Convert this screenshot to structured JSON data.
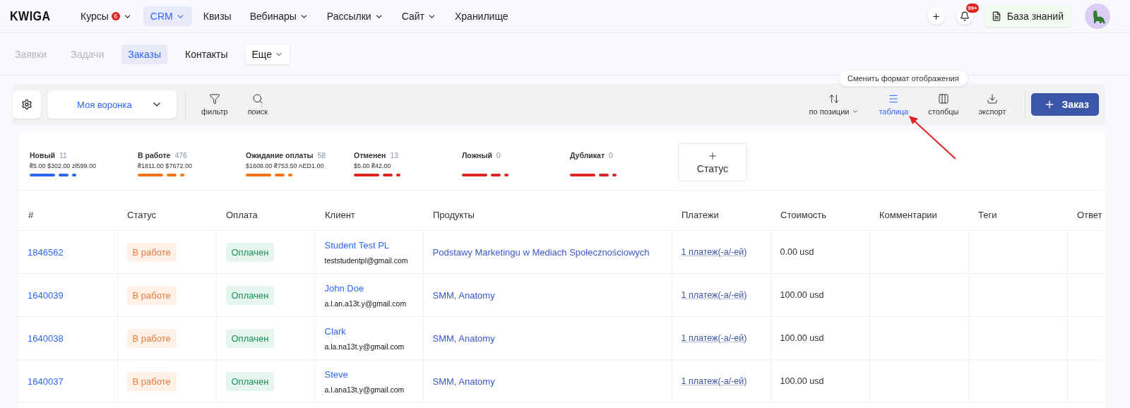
{
  "logo": "KWIGA",
  "nav": [
    {
      "label": "Курсы",
      "selected": false,
      "menu": true,
      "badge": "6"
    },
    {
      "label": "CRM",
      "selected": true,
      "menu": true
    },
    {
      "label": "Квизы",
      "selected": false,
      "menu": false
    },
    {
      "label": "Вебинары",
      "selected": false,
      "menu": true
    },
    {
      "label": "Рассылки",
      "selected": false,
      "menu": true
    },
    {
      "label": "Сайт",
      "selected": false,
      "menu": true
    },
    {
      "label": "Хранилище",
      "selected": false,
      "menu": false
    }
  ],
  "header_actions": {
    "notifications_badge": "99+",
    "knowledge_base": "База знаний"
  },
  "subnav": [
    {
      "label": "Заявки",
      "selected": false,
      "disabled": true
    },
    {
      "label": "Задачи",
      "selected": false,
      "disabled": true
    },
    {
      "label": "Заказы",
      "selected": true,
      "disabled": false
    },
    {
      "label": "Контакты",
      "selected": false,
      "disabled": false
    }
  ],
  "subnav_more": "Еще",
  "toolbar": {
    "funnel": "Моя воронка",
    "left_tools": [
      {
        "kind": "filter",
        "label": "фильтр"
      },
      {
        "kind": "search",
        "label": "поиск"
      }
    ],
    "right_tools": [
      {
        "kind": "sort",
        "label": "по позиции",
        "selected": false,
        "menu": true
      },
      {
        "kind": "table",
        "label": "таблица",
        "selected": true,
        "menu": false
      },
      {
        "kind": "columns",
        "label": "столбцы",
        "selected": false,
        "menu": false
      },
      {
        "kind": "export",
        "label": "экспорт",
        "selected": false,
        "menu": false
      }
    ],
    "tooltip": "Сменить формат отображения",
    "add_button": "Заказ"
  },
  "statuses": [
    {
      "name": "Новый",
      "count": "11",
      "amounts": "₴5.00 $302.00 zł599.00",
      "color": "#2f66f6"
    },
    {
      "name": "В работе",
      "count": "476",
      "amounts": "₴1811.00 $7672.00",
      "color": "#f97316"
    },
    {
      "name": "Ожидание оплаты",
      "count": "58",
      "amounts": "$1608.00 ₴753.50 AED1.00",
      "color": "#f97316"
    },
    {
      "name": "Отменен",
      "count": "13",
      "amounts": "$5.00 ₴42.00",
      "color": "#dc2626"
    },
    {
      "name": "Ложный",
      "count": "0",
      "color": "#dc2626"
    },
    {
      "name": "Дубликат",
      "count": "0",
      "color": "#dc2626"
    }
  ],
  "add_status": "Статус",
  "table": {
    "columns": [
      "#",
      "Статус",
      "Оплата",
      "Клиент",
      "Продукты",
      "Платежи",
      "Стоимость",
      "Комментарии",
      "Теги",
      "Ответ"
    ],
    "rows": [
      {
        "id": "1846562",
        "status": "В работе",
        "payment": "Оплачен",
        "client": "Student Test PL",
        "email": "teststudentpl@gmail.com",
        "products": "Podstawy Marketingu w Mediach Społecznościowych",
        "payments": "1 платеж(-а/-ей)",
        "cost": "0.00 usd"
      },
      {
        "id": "1640039",
        "status": "В работе",
        "payment": "Оплачен",
        "client": "John Doe",
        "email": "a.l.an.a13t.y@gmail.com",
        "products": "SMM, Anatomy",
        "payments": "1 платеж(-а/-ей)",
        "cost": "100.00 usd"
      },
      {
        "id": "1640038",
        "status": "В работе",
        "payment": "Оплачен",
        "client": "Clark",
        "email": "a.la.na13t.y@gmail.com",
        "products": "SMM, Anatomy",
        "payments": "1 платеж(-а/-ей)",
        "cost": "100.00 usd"
      },
      {
        "id": "1640037",
        "status": "В работе",
        "payment": "Оплачен",
        "client": "Steve",
        "email": "a.l.ana13t.y@gmail.com",
        "products": "SMM, Anatomy",
        "payments": "1 платеж(-а/-ей)",
        "cost": "100.00 usd"
      }
    ]
  }
}
